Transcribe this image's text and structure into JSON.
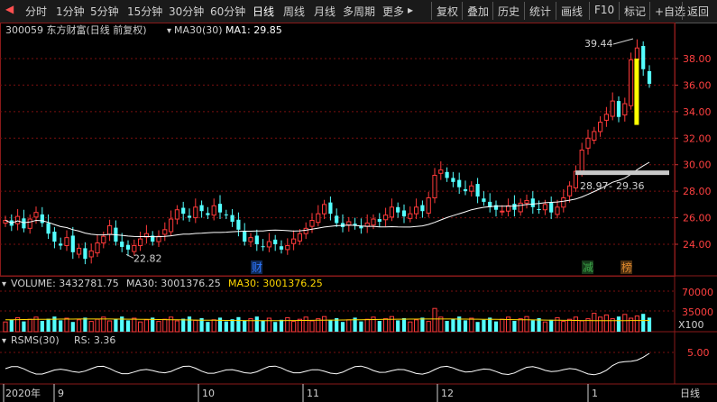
{
  "toolbar": {
    "left_icon": "back-arrow-icon",
    "periods": [
      "分时",
      "1分钟",
      "5分钟",
      "15分钟",
      "30分钟",
      "60分钟",
      "日线",
      "周线",
      "月线",
      "多周期",
      "更多"
    ],
    "active_period": "日线",
    "more_arrow": "▸",
    "actions": [
      "复权",
      "叠加",
      "历史",
      "统计",
      "画线",
      "F10",
      "标记",
      "+自选",
      "返回"
    ]
  },
  "main_panel": {
    "stock_label": "300059 东方财富(日线 前复权)",
    "ma_dropdown_label": "MA30(30)",
    "ma_value": "MA1: 29.85",
    "price_axis": [
      "38.00",
      "36.00",
      "34.00",
      "32.00",
      "30.00",
      "28.00",
      "26.00",
      "24.00"
    ],
    "annotations": {
      "high": "39.44",
      "low": "22.82",
      "range_left": "28.97",
      "range_sep": "-",
      "range_right": "29.36"
    },
    "event_markers": [
      {
        "label": "财",
        "color": "#2e78ff"
      },
      {
        "label": "减",
        "color": "#3ea84a"
      },
      {
        "label": "榜",
        "color": "#e08a2e"
      }
    ]
  },
  "volume_panel": {
    "label": "VOLUME: 3432781.75",
    "ma_label": "MA30: 3001376.25",
    "ma_label2": "MA30: 3001376.25",
    "axis": [
      "70000",
      "35000"
    ],
    "unit": "X100"
  },
  "rsms_panel": {
    "label": "RSMS(30)",
    "value": "RS: 3.36",
    "axis": [
      "5.00"
    ]
  },
  "date_axis": {
    "labels": [
      "2020年",
      "9",
      "10",
      "11",
      "12",
      "1"
    ],
    "right_label": "日线"
  },
  "colors": {
    "up": "#ff3a3a",
    "down": "#54ffff",
    "ma": "#ffffff",
    "volume_ma": "#ffd700",
    "highlight": "#ffff00",
    "grid": "#7a1010",
    "axis_text": "#ff4040"
  },
  "chart_data": {
    "type": "candlestick",
    "price_range": [
      22.82,
      39.44
    ],
    "ohlc_x_labels": [
      "2020年",
      "9",
      "10",
      "11",
      "12",
      "1"
    ],
    "closes": [
      25.8,
      25.4,
      26.1,
      25.2,
      25.9,
      26.4,
      25.6,
      24.8,
      24.2,
      23.9,
      24.5,
      23.4,
      23.7,
      22.9,
      23.5,
      24.1,
      24.6,
      25.4,
      24.2,
      23.8,
      23.6,
      23.9,
      24.4,
      24.8,
      24.2,
      24.6,
      25.1,
      25.9,
      26.6,
      26.3,
      26.0,
      26.8,
      26.5,
      26.2,
      26.9,
      26.4,
      26.2,
      25.7,
      25.1,
      24.2,
      24.5,
      24.0,
      23.8,
      24.2,
      24.0,
      23.6,
      23.9,
      24.4,
      24.8,
      25.2,
      25.8,
      26.3,
      27.0,
      26.3,
      25.6,
      25.3,
      25.7,
      25.4,
      25.2,
      25.6,
      25.9,
      25.7,
      26.2,
      26.8,
      26.4,
      26.1,
      26.3,
      26.8,
      26.5,
      27.5,
      29.2,
      29.6,
      29.0,
      28.7,
      28.3,
      28.0,
      28.4,
      27.6,
      27.2,
      26.8,
      26.6,
      26.5,
      26.9,
      26.6,
      27.1,
      27.3,
      26.8,
      26.6,
      27.0,
      26.4,
      26.8,
      27.5,
      28.4,
      29.5,
      31.1,
      32.0,
      32.5,
      33.2,
      33.8,
      34.8,
      33.6,
      34.6,
      37.9,
      38.8,
      37.2,
      36.1
    ],
    "ma30_end": 29.85,
    "volume_last": 3432781.75,
    "volume_ma30": 3001376.25,
    "rs_last": 3.36
  }
}
